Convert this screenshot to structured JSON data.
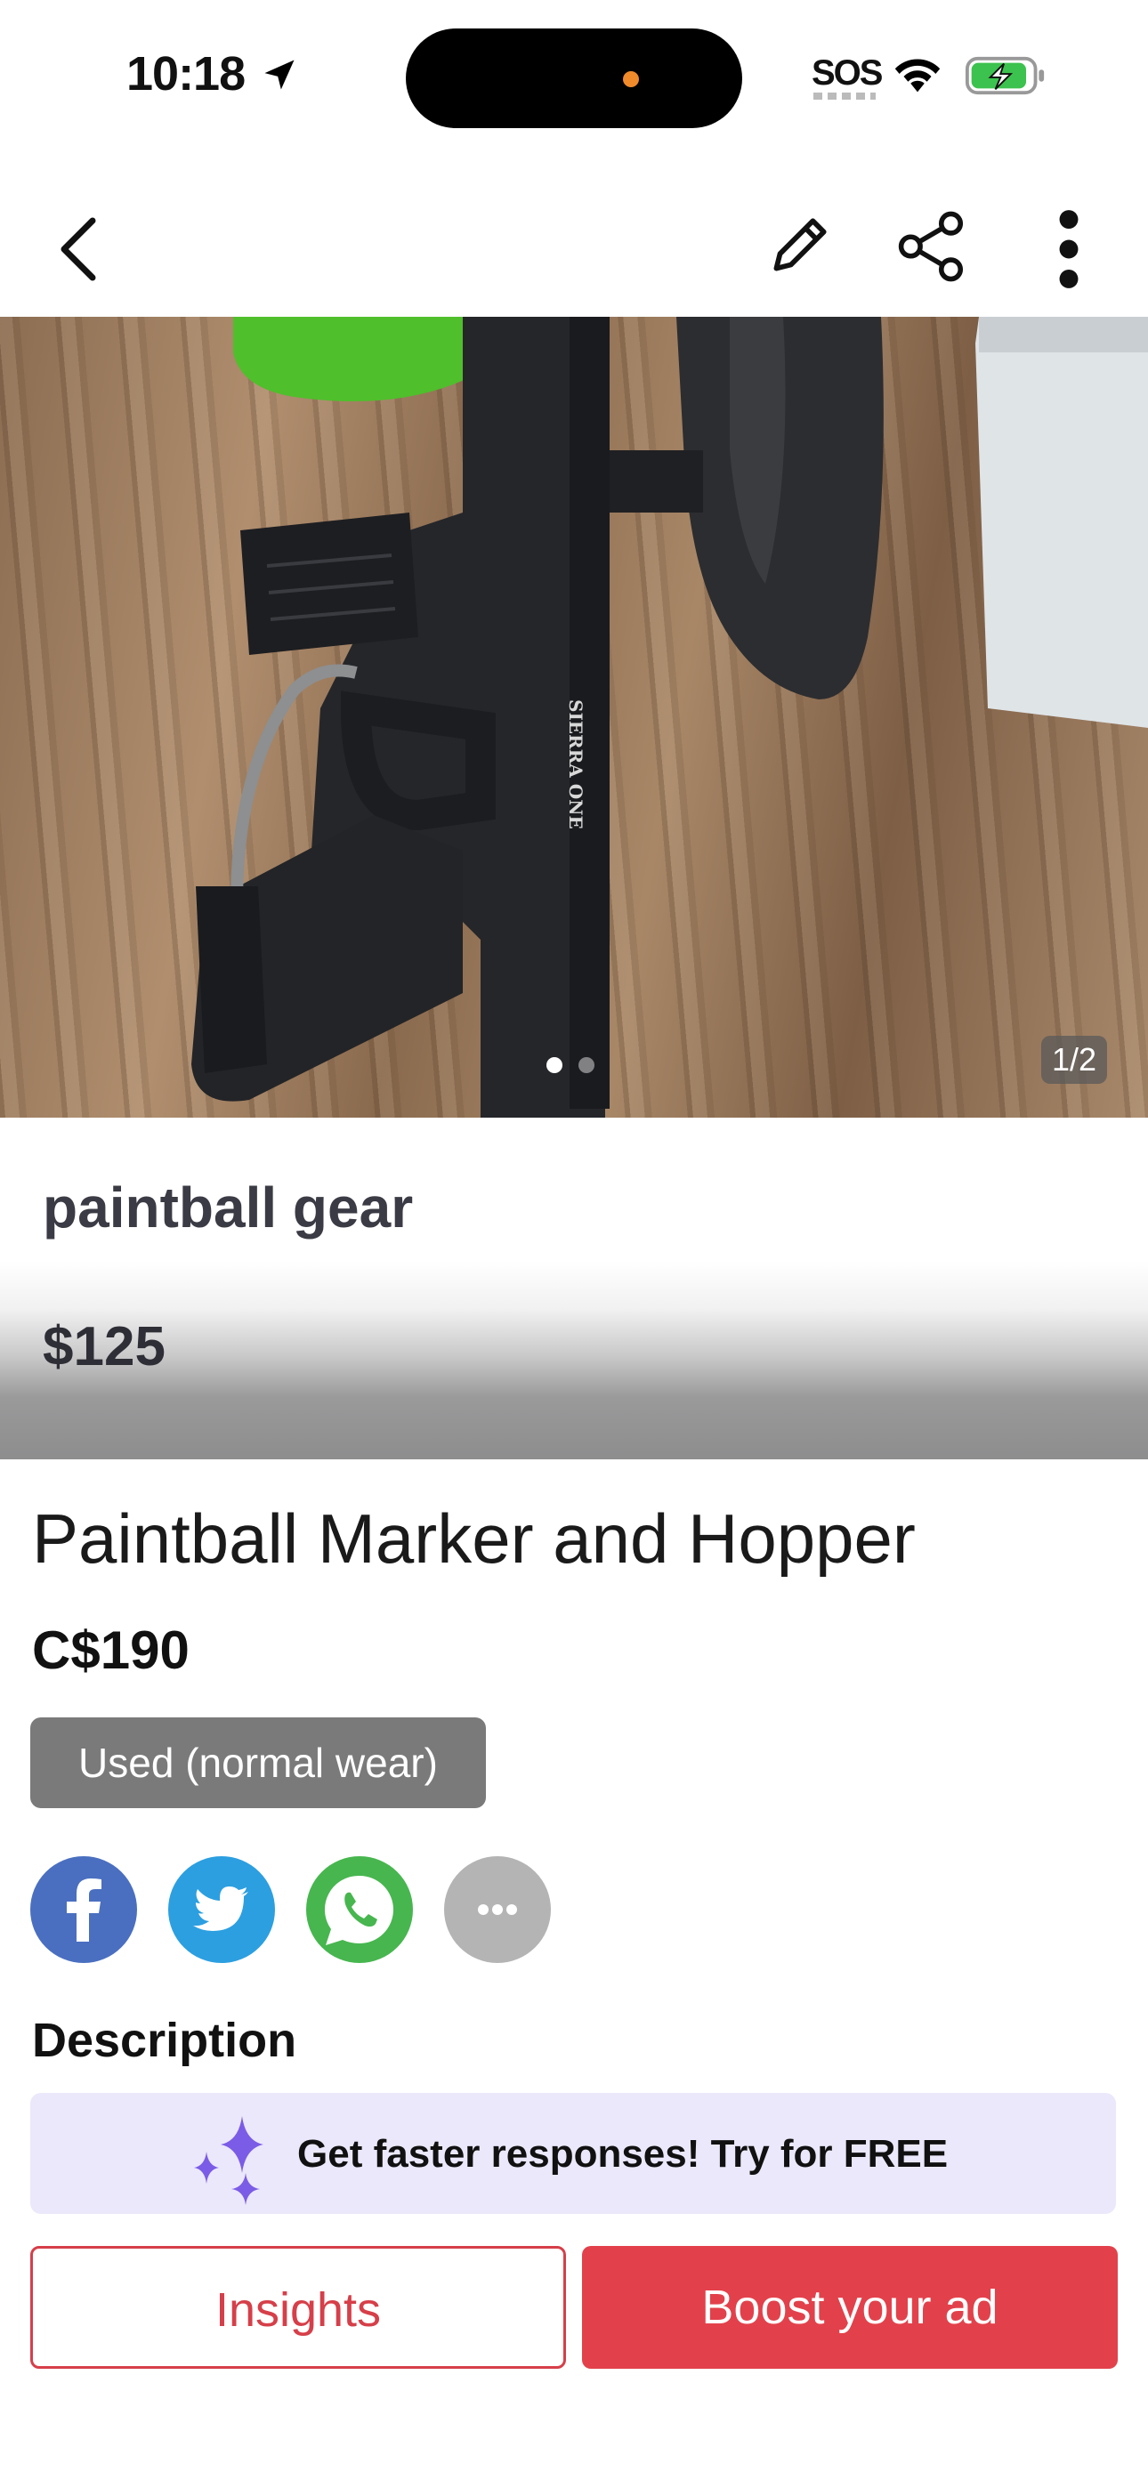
{
  "status_bar": {
    "time": "10:18",
    "sos": "SOS"
  },
  "nav": {
    "back_icon": "chevron-left-icon",
    "edit_icon": "pencil-icon",
    "share_icon": "share-icon",
    "more_icon": "more-vertical-icon"
  },
  "photo": {
    "counter": "1/2",
    "current_index": 1,
    "total": 2
  },
  "ad_card": {
    "title": "paintball gear",
    "price": "$125"
  },
  "listing": {
    "title": "Paintball Marker and Hopper",
    "price": "C$190",
    "condition": "Used (normal wear)"
  },
  "share_buttons": [
    {
      "name": "facebook",
      "icon": "facebook-icon",
      "color": "#4a6fc0"
    },
    {
      "name": "twitter",
      "icon": "twitter-icon",
      "color": "#2c9fe0"
    },
    {
      "name": "whatsapp",
      "icon": "whatsapp-icon",
      "color": "#47b64f"
    },
    {
      "name": "more",
      "icon": "ellipsis-icon",
      "color": "#b4b4b4"
    }
  ],
  "description": {
    "heading": "Description"
  },
  "promo": {
    "text": "Get faster responses!  Try for FREE",
    "icon": "sparkle-icon"
  },
  "actions": {
    "insights_label": "Insights",
    "boost_label": "Boost your ad"
  },
  "colors": {
    "accent": "#e2414b",
    "promo_bg": "#ebe8fb",
    "condition_bg": "#7a7a7a"
  }
}
